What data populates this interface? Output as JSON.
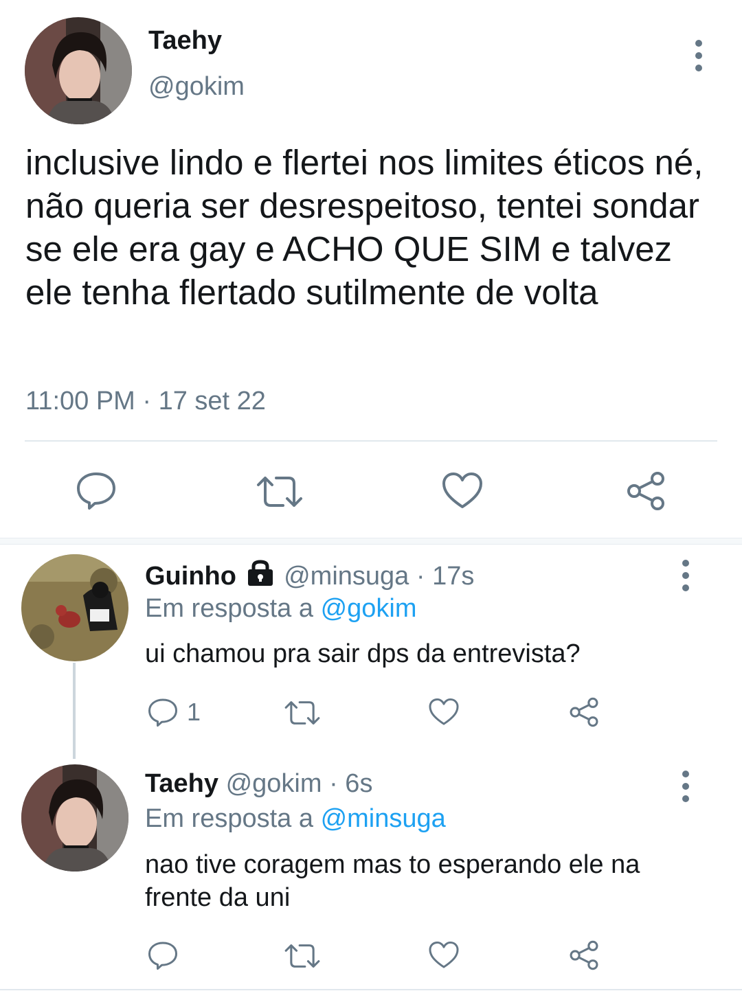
{
  "main_tweet": {
    "display_name": "Taehy",
    "handle": "@gokim",
    "text": "inclusive lindo e flertei nos limites éticos né, não queria ser desrespeitoso, tentei sondar se ele era gay e ACHO QUE SIM e talvez ele tenha flertado sutilmente de volta",
    "timestamp": "11:00 PM · 17 set 22"
  },
  "replies": [
    {
      "display_name": "Guinho",
      "handle": "@minsuga",
      "time": "· 17s",
      "reply_prefix": "Em resposta a",
      "reply_to": "@gokim",
      "text": "ui chamou pra sair dps da entrevista?",
      "reply_count": "1"
    },
    {
      "display_name": "Taehy",
      "handle": "@gokim",
      "time": "· 6s",
      "reply_prefix": "Em resposta a",
      "reply_to": "@minsuga",
      "text": "nao tive coragem mas to esperando ele na frente da uni"
    }
  ],
  "icons": {
    "reply": "speech-bubble-icon",
    "retweet": "retweet-icon",
    "like": "heart-icon",
    "share": "share-icon",
    "more": "vertical-dots-icon",
    "protected": "lock-icon"
  },
  "colors": {
    "text": "#14171a",
    "muted": "#657786",
    "link": "#1da1f2",
    "divider": "#e1e8ed"
  }
}
